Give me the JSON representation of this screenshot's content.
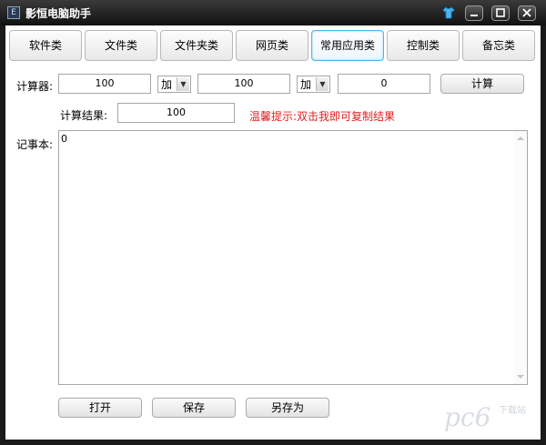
{
  "window": {
    "title": "影恒电脑助手"
  },
  "tabs": [
    "软件类",
    "文件类",
    "文件夹类",
    "网页类",
    "常用应用类",
    "控制类",
    "备忘类"
  ],
  "active_tab_index": 4,
  "calculator": {
    "label": "计算器:",
    "operand1": "100",
    "op1": "加",
    "operand2": "100",
    "op2": "加",
    "operand3": "0",
    "calc_button": "计算",
    "result_label": "计算结果:",
    "result_value": "100",
    "hint": "温馨提示:双击我即可复制结果"
  },
  "notepad": {
    "label": "记事本:",
    "content": "0"
  },
  "buttons": {
    "open": "打开",
    "save": "保存",
    "save_as": "另存为"
  },
  "watermark": {
    "text": "pc6 下载站"
  },
  "colors": {
    "hint": "#e02020",
    "active_tab_border": "#4fb6e6",
    "title_bar": "#1a1a1a"
  }
}
